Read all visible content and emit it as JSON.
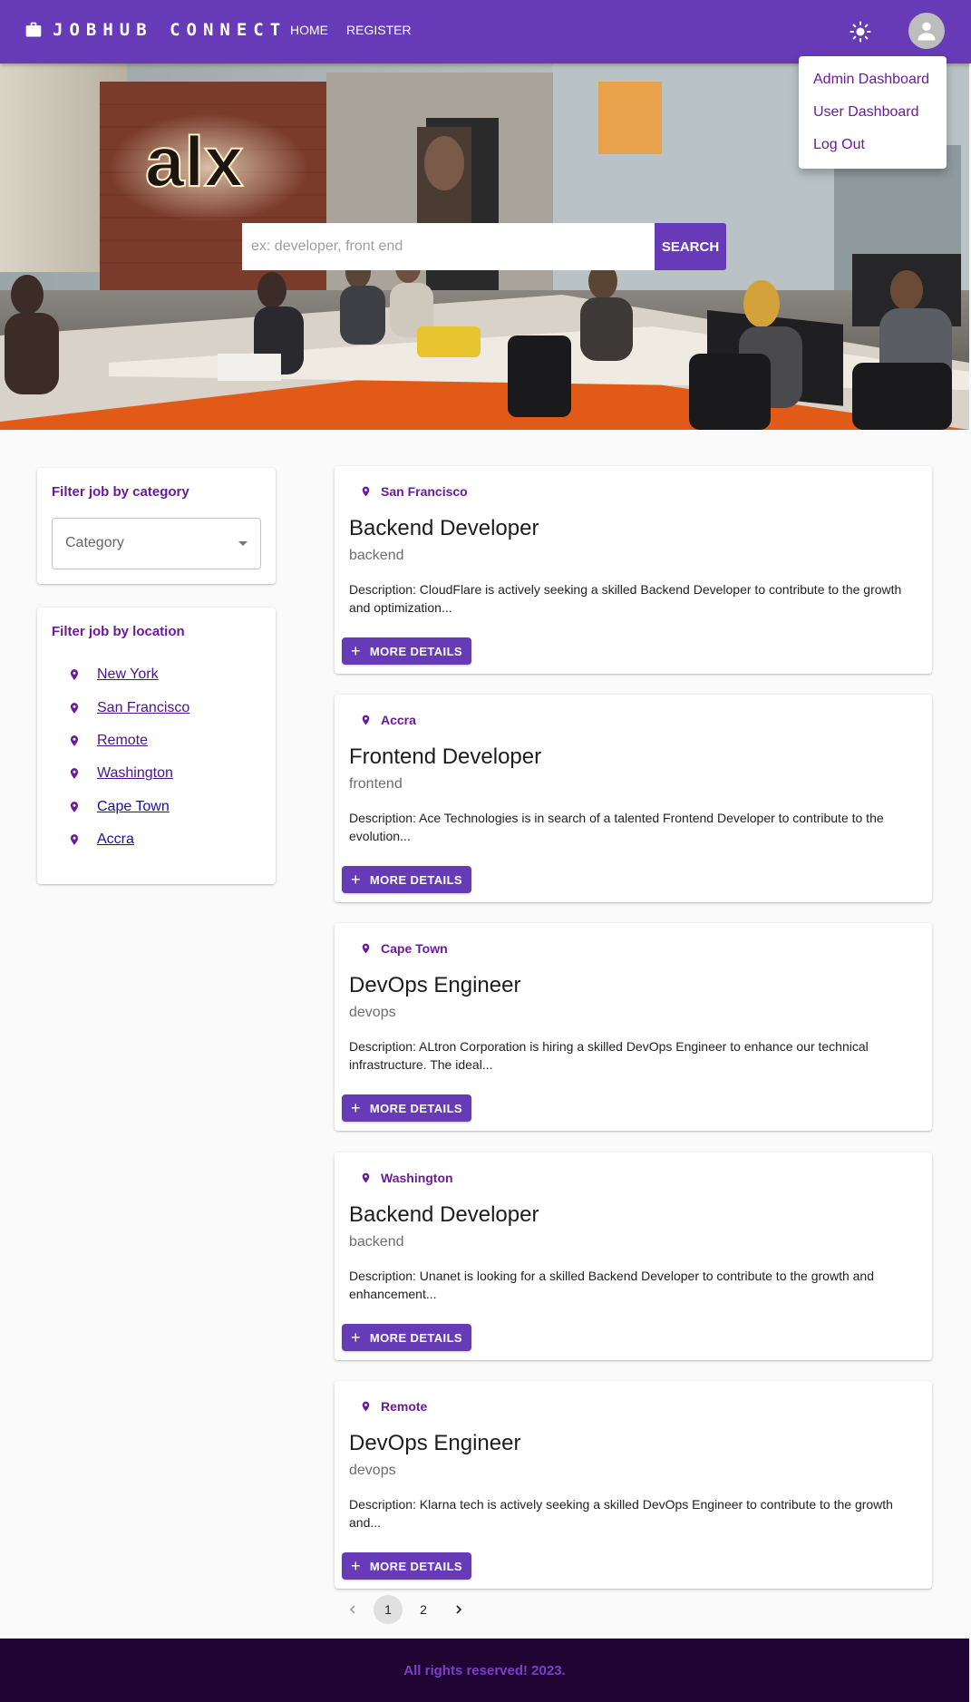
{
  "header": {
    "brand": "JOBHUB CONNECT",
    "nav": [
      "HOME",
      "REGISTER"
    ]
  },
  "menu": {
    "items": [
      "Admin Dashboard",
      "User Dashboard",
      "Log Out"
    ]
  },
  "search": {
    "placeholder": "ex: developer, front end",
    "button": "SEARCH"
  },
  "filters": {
    "category_title": "Filter job by category",
    "category_label": "Category",
    "location_title": "Filter job by location",
    "locations": [
      "New York",
      "San Francisco",
      "Remote",
      "Washington",
      "Cape Town",
      "Accra"
    ]
  },
  "jobs": [
    {
      "location": "San Francisco",
      "title": "Backend Developer",
      "category": "backend",
      "description": "Description: CloudFlare is actively seeking a skilled Backend Developer to contribute to the growth and optimization...",
      "button": "MORE DETAILS"
    },
    {
      "location": "Accra",
      "title": "Frontend Developer",
      "category": "frontend",
      "description": "Description: Ace Technologies is in search of a talented Frontend Developer to contribute to the evolution...",
      "button": "MORE DETAILS"
    },
    {
      "location": "Cape Town",
      "title": "DevOps Engineer",
      "category": "devops",
      "description": "Description: ALtron Corporation is hiring a skilled DevOps Engineer to enhance our technical infrastructure. The ideal...",
      "button": "MORE DETAILS"
    },
    {
      "location": "Washington",
      "title": "Backend Developer",
      "category": "backend",
      "description": "Description: Unanet is looking for a skilled Backend Developer to contribute to the growth and enhancement...",
      "button": "MORE DETAILS"
    },
    {
      "location": "Remote",
      "title": "DevOps Engineer",
      "category": "devops",
      "description": "Description: Klarna tech is actively seeking a skilled DevOps Engineer to contribute to the growth and...",
      "button": "MORE DETAILS"
    }
  ],
  "pagination": {
    "pages": [
      "1",
      "2"
    ],
    "current": "1"
  },
  "hero_sign": "alx",
  "footer": {
    "text": "All rights reserved! 2023."
  },
  "colors": {
    "primary": "#673ab7",
    "accent_text": "#6a1b9a",
    "footer_bg": "#1f0434"
  }
}
